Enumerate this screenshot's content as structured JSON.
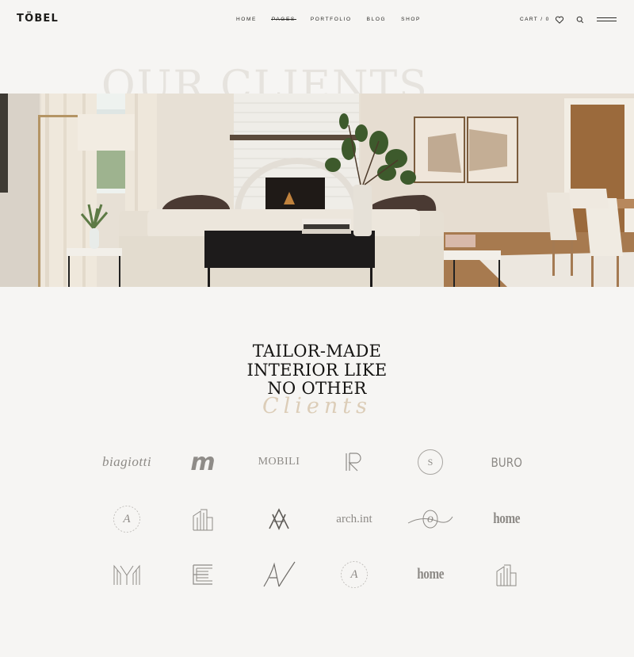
{
  "brand": {
    "logo": "TÖBEL"
  },
  "nav": {
    "items": [
      {
        "label": "HOME"
      },
      {
        "label": "PAGES"
      },
      {
        "label": "PORTFOLIO"
      },
      {
        "label": "BLOG"
      },
      {
        "label": "SHOP"
      }
    ],
    "cart_label": "CART / 0"
  },
  "hero": {
    "ghost_title": "OUR CLIENTS"
  },
  "section": {
    "headline": [
      "TAILOR-MADE",
      "INTERIOR LIKE",
      "NO OTHER"
    ],
    "script_word": "Clients"
  },
  "clients": {
    "row1": [
      "biagiotti",
      "m",
      "MOBILI",
      "R",
      "S",
      "BURO"
    ],
    "row2": [
      "A",
      "B",
      "AV",
      "arch.int",
      "o",
      "home"
    ],
    "row3": [
      "M",
      "E",
      "AV",
      "A",
      "home",
      "B"
    ]
  },
  "colors": {
    "background": "#f6f5f3",
    "text": "#1c1b19",
    "logo_gray": "#8d8a86",
    "script_beige": "#d8c7ae"
  }
}
